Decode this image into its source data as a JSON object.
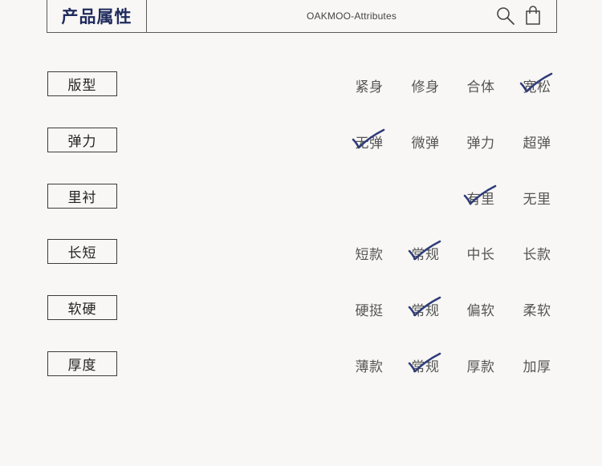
{
  "header": {
    "title": "产品属性",
    "subtitle": "OAKMOO-Attributes",
    "icons": [
      "search-icon",
      "shopping-bag-icon"
    ]
  },
  "colors": {
    "accent": "#1f2a5c",
    "check": "#2f3d78"
  },
  "rows": [
    {
      "label": "版型",
      "options": [
        "紧身",
        "修身",
        "合体",
        "宽松"
      ],
      "selected": [
        "宽松"
      ]
    },
    {
      "label": "弹力",
      "options": [
        "无弹",
        "微弹",
        "弹力",
        "超弹"
      ],
      "selected": [
        "无弹"
      ]
    },
    {
      "label": "里衬",
      "options": [
        "有里",
        "无里"
      ],
      "selected": [
        "有里"
      ]
    },
    {
      "label": "长短",
      "options": [
        "短款",
        "常规",
        "中长",
        "长款"
      ],
      "selected": [
        "常规"
      ]
    },
    {
      "label": "软硬",
      "options": [
        "硬挺",
        "常规",
        "偏软",
        "柔软"
      ],
      "selected": [
        "常规"
      ]
    },
    {
      "label": "厚度",
      "options": [
        "薄款",
        "常规",
        "厚款",
        "加厚"
      ],
      "selected": [
        "常规"
      ]
    }
  ]
}
